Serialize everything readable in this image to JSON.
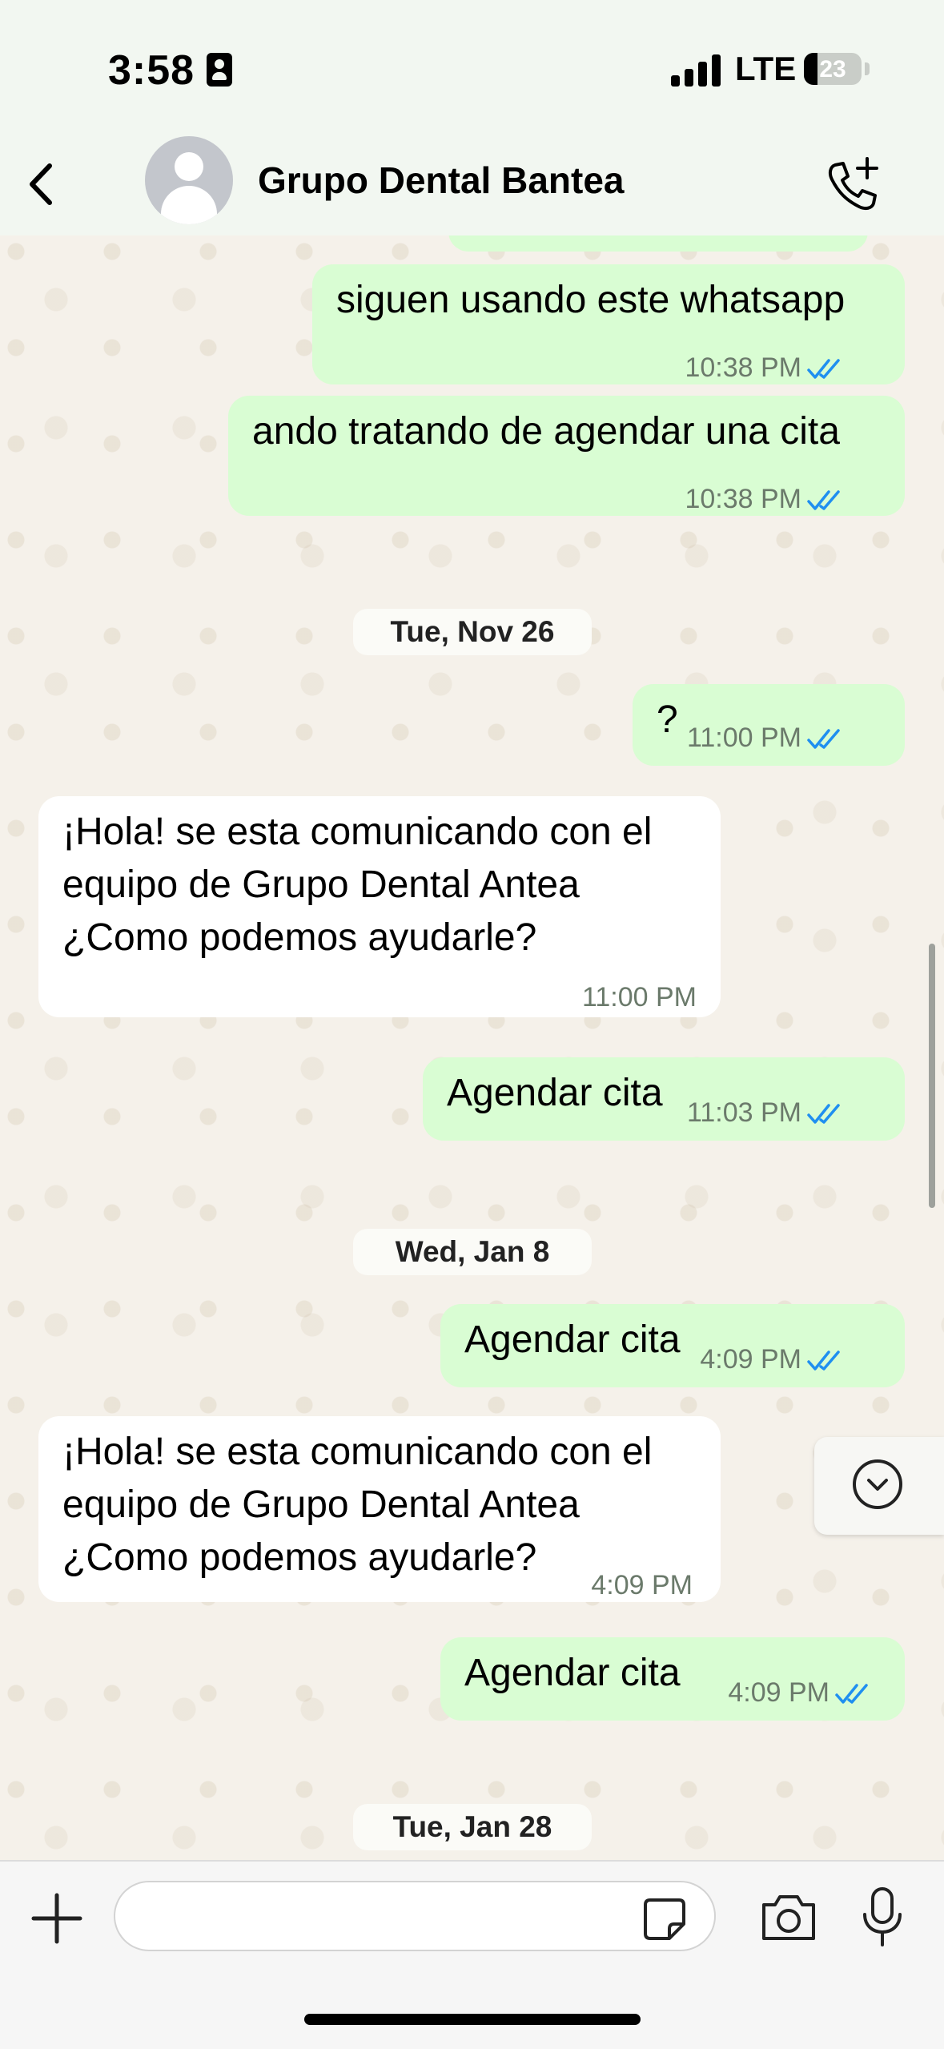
{
  "status_bar": {
    "time": "3:58",
    "network": "LTE",
    "battery": "23",
    "battery_level": 0.23
  },
  "header": {
    "title": "Grupo Dental Bantea"
  },
  "messages": [
    {
      "dir": "out",
      "text": "siguen usando este whatsapp",
      "time": "10:38 PM",
      "read": true
    },
    {
      "dir": "out",
      "text": "ando tratando de agendar una cita",
      "time": "10:38 PM",
      "read": true
    },
    {
      "dir": "date",
      "text": "Tue, Nov 26"
    },
    {
      "dir": "out",
      "text": "?",
      "time": "11:00 PM",
      "read": true
    },
    {
      "dir": "in",
      "text": "¡Hola! se esta comunicando con el\nequipo de Grupo Dental Antea\n¿Como podemos ayudarle?",
      "time": "11:00 PM"
    },
    {
      "dir": "out",
      "text": "Agendar cita",
      "time": "11:03 PM",
      "read": true
    },
    {
      "dir": "date",
      "text": "Wed, Jan 8"
    },
    {
      "dir": "out",
      "text": "Agendar cita",
      "time": "4:09 PM",
      "read": true
    },
    {
      "dir": "in",
      "text": "¡Hola! se esta comunicando con el\nequipo de Grupo Dental Antea\n¿Como podemos ayudarle?",
      "time": "4:09 PM"
    },
    {
      "dir": "out",
      "text": "Agendar cita",
      "time": "4:09 PM",
      "read": true
    },
    {
      "dir": "date",
      "text": "Tue, Jan 28"
    }
  ],
  "composer": {
    "placeholder": ""
  },
  "colors": {
    "outgoing": "#d9fdd3",
    "incoming": "#ffffff",
    "read_tick": "#1f8ff0",
    "header": "#f2f7f1"
  },
  "icons": [
    "back-chevron-icon",
    "avatar-placeholder-icon",
    "add-call-icon",
    "plus-icon",
    "sticker-icon",
    "camera-icon",
    "microphone-icon",
    "scroll-down-icon"
  ]
}
